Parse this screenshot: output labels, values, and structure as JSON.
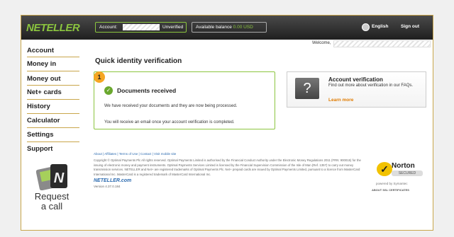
{
  "header": {
    "logo": "NETELLER",
    "account_label": "Account:",
    "account_status": "Unverified",
    "balance_label": "Available balance",
    "balance_value": "0.00 USD",
    "language": "English",
    "signout": "Sign out"
  },
  "sidebar": {
    "items": [
      {
        "label": "Account"
      },
      {
        "label": "Money in"
      },
      {
        "label": "Money out"
      },
      {
        "label": "Net+ cards"
      },
      {
        "label": "History"
      },
      {
        "label": "Calculator"
      },
      {
        "label": "Settings"
      },
      {
        "label": "Support"
      }
    ],
    "cta_line1": "Request",
    "cta_line2": "a call"
  },
  "welcome": "Welcome,",
  "main": {
    "title": "Quick identity verification",
    "step_number": "1",
    "doc_title": "Documents received",
    "doc_text1": "We have received your documents and they are now being processed.",
    "doc_text2": "You will receive an email once your account verification is completed."
  },
  "verify": {
    "title": "Account verification",
    "text": "Find out more about verification in our FAQs.",
    "link": "Learn more",
    "icon": "question-mark-icon"
  },
  "footer": {
    "links": "About | Affiliates | Terms of Use | Contact | Visit mobile site",
    "legal": "Copyright © Optimal Payments Plc All rights reserved. Optimal Payments Limited is authorised by the Financial Conduct Authority under the Electronic Money Regulations 2011 (FRN: 900015) for the issuing of electronic money and payment instruments. Optimal Payments Services Limited is licensed by the Financial Supervision Commission of the Isle of Man (Ref. 1357) to carry out money transmission services. NETELLER and Net+ are registered trademarks of Optimal Payments Plc. Net+ prepaid cards are issued by Optimal Payments Limited, pursuant to a licence from MasterCard International Inc. MasterCard is a registered trademark of MasterCard International Inc.",
    "brand": "NETELLER.com",
    "version": "Version 4.37.0.184"
  },
  "norton": {
    "name": "Norton",
    "secured": "SECURED",
    "powered": "powered by Symantec",
    "about": "ABOUT SSL CERTIFICATES"
  },
  "colors": {
    "accent": "#8bc53f",
    "link": "#2c6bb0",
    "orange": "#e07b00",
    "border": "#c9a64b"
  }
}
